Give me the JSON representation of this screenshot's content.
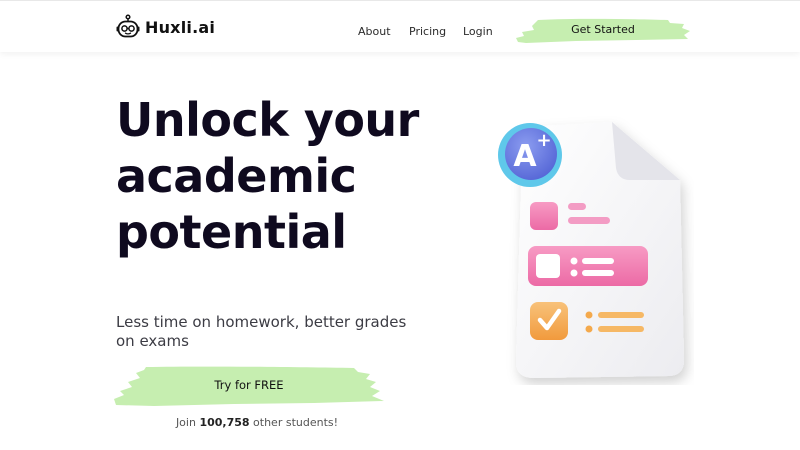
{
  "header": {
    "logo_text": "Huxli.ai",
    "nav": [
      {
        "label": "About"
      },
      {
        "label": "Pricing"
      },
      {
        "label": "Login"
      }
    ],
    "cta_label": "Get Started"
  },
  "hero": {
    "title_lines": [
      "Unlock your",
      "academic",
      "potential"
    ],
    "subtitle": "Less time on homework, better grades on exams",
    "cta_label": "Try for FREE",
    "join_prefix": "Join ",
    "join_count": "100,758",
    "join_suffix": " other students!"
  },
  "illustration": {
    "grade_badge": "A",
    "grade_plus": "+",
    "icon": "graded-document-illustration"
  },
  "colors": {
    "cta_green": "#c6eeb0",
    "title_dark": "#0f0a1f",
    "badge_blue": "#6a7fe0",
    "badge_ring": "#5fc8ea",
    "pink": "#f27ab0",
    "orange": "#f4a94c"
  }
}
